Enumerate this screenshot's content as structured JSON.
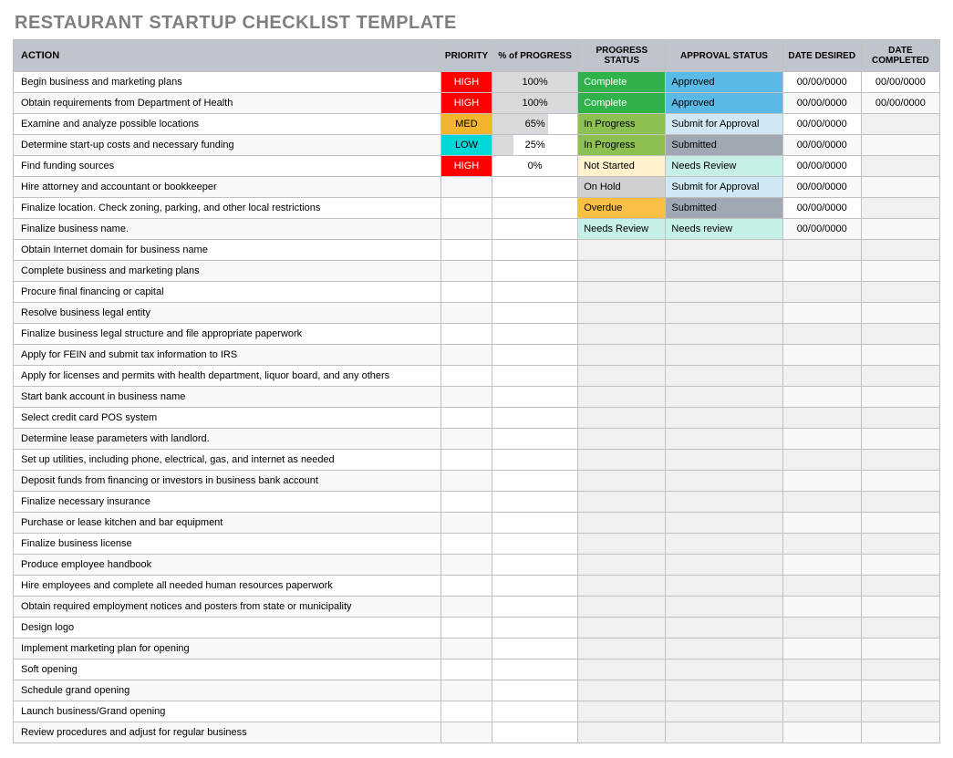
{
  "title": "RESTAURANT STARTUP CHECKLIST TEMPLATE",
  "headers": {
    "action": "ACTION",
    "priority": "PRIORITY",
    "progress": "% of PROGRESS",
    "progress_status": "PROGRESS STATUS",
    "approval_status": "APPROVAL STATUS",
    "date_desired": "DATE DESIRED",
    "date_completed": "DATE COMPLETED"
  },
  "rows": [
    {
      "action": "Begin business and marketing plans",
      "priority": "HIGH",
      "progress": "100%",
      "progress_pct": 100,
      "progress_status": "Complete",
      "approval_status": "Approved",
      "date_desired": "00/00/0000",
      "date_completed": "00/00/0000"
    },
    {
      "action": "Obtain requirements from Department of Health",
      "priority": "HIGH",
      "progress": "100%",
      "progress_pct": 100,
      "progress_status": "Complete",
      "approval_status": "Approved",
      "date_desired": "00/00/0000",
      "date_completed": "00/00/0000"
    },
    {
      "action": "Examine and analyze possible locations",
      "priority": "MED",
      "progress": "65%",
      "progress_pct": 65,
      "progress_status": "In Progress",
      "approval_status": "Submit for Approval",
      "date_desired": "00/00/0000",
      "date_completed": ""
    },
    {
      "action": "Determine start-up costs and necessary funding",
      "priority": "LOW",
      "progress": "25%",
      "progress_pct": 25,
      "progress_status": "In Progress",
      "approval_status": "Submitted",
      "date_desired": "00/00/0000",
      "date_completed": ""
    },
    {
      "action": "Find funding sources",
      "priority": "HIGH",
      "progress": "0%",
      "progress_pct": 0,
      "progress_status": "Not Started",
      "approval_status": "Needs Review",
      "date_desired": "00/00/0000",
      "date_completed": ""
    },
    {
      "action": "Hire attorney and accountant or bookkeeper",
      "priority": "",
      "progress": "",
      "progress_pct": null,
      "progress_status": "On Hold",
      "approval_status": "Submit for Approval",
      "date_desired": "00/00/0000",
      "date_completed": ""
    },
    {
      "action": "Finalize location. Check zoning, parking, and other local restrictions",
      "priority": "",
      "progress": "",
      "progress_pct": null,
      "progress_status": "Overdue",
      "approval_status": "Submitted",
      "date_desired": "00/00/0000",
      "date_completed": ""
    },
    {
      "action": "Finalize business name.",
      "priority": "",
      "progress": "",
      "progress_pct": null,
      "progress_status": "Needs Review",
      "approval_status": "Needs review",
      "date_desired": "00/00/0000",
      "date_completed": ""
    },
    {
      "action": "Obtain Internet domain for business name",
      "priority": "",
      "progress": "",
      "progress_pct": null,
      "progress_status": "",
      "approval_status": "",
      "date_desired": "",
      "date_completed": ""
    },
    {
      "action": "Complete business and marketing plans",
      "priority": "",
      "progress": "",
      "progress_pct": null,
      "progress_status": "",
      "approval_status": "",
      "date_desired": "",
      "date_completed": ""
    },
    {
      "action": "Procure final financing or capital",
      "priority": "",
      "progress": "",
      "progress_pct": null,
      "progress_status": "",
      "approval_status": "",
      "date_desired": "",
      "date_completed": ""
    },
    {
      "action": "Resolve business legal entity",
      "priority": "",
      "progress": "",
      "progress_pct": null,
      "progress_status": "",
      "approval_status": "",
      "date_desired": "",
      "date_completed": ""
    },
    {
      "action": "Finalize business legal structure and file appropriate paperwork",
      "priority": "",
      "progress": "",
      "progress_pct": null,
      "progress_status": "",
      "approval_status": "",
      "date_desired": "",
      "date_completed": ""
    },
    {
      "action": "Apply for FEIN and submit tax information to IRS",
      "priority": "",
      "progress": "",
      "progress_pct": null,
      "progress_status": "",
      "approval_status": "",
      "date_desired": "",
      "date_completed": ""
    },
    {
      "action": "Apply for licenses and permits with health department, liquor board, and any others",
      "priority": "",
      "progress": "",
      "progress_pct": null,
      "progress_status": "",
      "approval_status": "",
      "date_desired": "",
      "date_completed": ""
    },
    {
      "action": "Start bank account in business name",
      "priority": "",
      "progress": "",
      "progress_pct": null,
      "progress_status": "",
      "approval_status": "",
      "date_desired": "",
      "date_completed": ""
    },
    {
      "action": "Select credit card POS system",
      "priority": "",
      "progress": "",
      "progress_pct": null,
      "progress_status": "",
      "approval_status": "",
      "date_desired": "",
      "date_completed": ""
    },
    {
      "action": "Determine lease parameters with landlord.",
      "priority": "",
      "progress": "",
      "progress_pct": null,
      "progress_status": "",
      "approval_status": "",
      "date_desired": "",
      "date_completed": ""
    },
    {
      "action": "Set up utilities, including phone, electrical, gas, and internet as needed",
      "priority": "",
      "progress": "",
      "progress_pct": null,
      "progress_status": "",
      "approval_status": "",
      "date_desired": "",
      "date_completed": ""
    },
    {
      "action": "Deposit funds from financing or investors in business bank account",
      "priority": "",
      "progress": "",
      "progress_pct": null,
      "progress_status": "",
      "approval_status": "",
      "date_desired": "",
      "date_completed": ""
    },
    {
      "action": "Finalize necessary insurance",
      "priority": "",
      "progress": "",
      "progress_pct": null,
      "progress_status": "",
      "approval_status": "",
      "date_desired": "",
      "date_completed": ""
    },
    {
      "action": "Purchase or lease kitchen and bar equipment",
      "priority": "",
      "progress": "",
      "progress_pct": null,
      "progress_status": "",
      "approval_status": "",
      "date_desired": "",
      "date_completed": ""
    },
    {
      "action": "Finalize business license",
      "priority": "",
      "progress": "",
      "progress_pct": null,
      "progress_status": "",
      "approval_status": "",
      "date_desired": "",
      "date_completed": ""
    },
    {
      "action": "Produce employee handbook",
      "priority": "",
      "progress": "",
      "progress_pct": null,
      "progress_status": "",
      "approval_status": "",
      "date_desired": "",
      "date_completed": ""
    },
    {
      "action": "Hire employees and complete all needed human resources paperwork",
      "priority": "",
      "progress": "",
      "progress_pct": null,
      "progress_status": "",
      "approval_status": "",
      "date_desired": "",
      "date_completed": ""
    },
    {
      "action": "Obtain required employment notices and posters from state or municipality",
      "priority": "",
      "progress": "",
      "progress_pct": null,
      "progress_status": "",
      "approval_status": "",
      "date_desired": "",
      "date_completed": ""
    },
    {
      "action": "Design logo",
      "priority": "",
      "progress": "",
      "progress_pct": null,
      "progress_status": "",
      "approval_status": "",
      "date_desired": "",
      "date_completed": ""
    },
    {
      "action": "Implement marketing plan for opening",
      "priority": "",
      "progress": "",
      "progress_pct": null,
      "progress_status": "",
      "approval_status": "",
      "date_desired": "",
      "date_completed": ""
    },
    {
      "action": "Soft opening",
      "priority": "",
      "progress": "",
      "progress_pct": null,
      "progress_status": "",
      "approval_status": "",
      "date_desired": "",
      "date_completed": ""
    },
    {
      "action": "Schedule grand opening",
      "priority": "",
      "progress": "",
      "progress_pct": null,
      "progress_status": "",
      "approval_status": "",
      "date_desired": "",
      "date_completed": ""
    },
    {
      "action": "Launch business/Grand opening",
      "priority": "",
      "progress": "",
      "progress_pct": null,
      "progress_status": "",
      "approval_status": "",
      "date_desired": "",
      "date_completed": ""
    },
    {
      "action": "Review procedures and adjust for regular business",
      "priority": "",
      "progress": "",
      "progress_pct": null,
      "progress_status": "",
      "approval_status": "",
      "date_desired": "",
      "date_completed": ""
    }
  ]
}
